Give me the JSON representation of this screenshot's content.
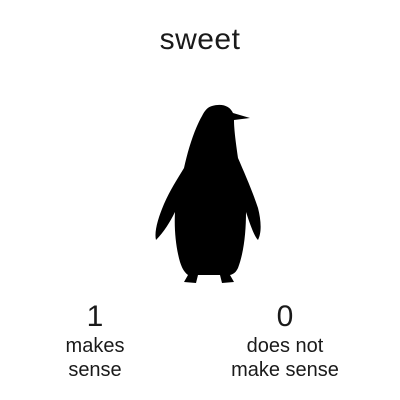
{
  "stimulus": {
    "word": "sweet",
    "image_icon": "penguin-silhouette-icon"
  },
  "options": {
    "left": {
      "key": "1",
      "label_line1": "makes",
      "label_line2": "sense"
    },
    "right": {
      "key": "0",
      "label_line1": "does not",
      "label_line2": "make sense"
    }
  },
  "colors": {
    "background": "#ffffff",
    "silhouette": "#000000",
    "text": "#1a1a1a"
  }
}
